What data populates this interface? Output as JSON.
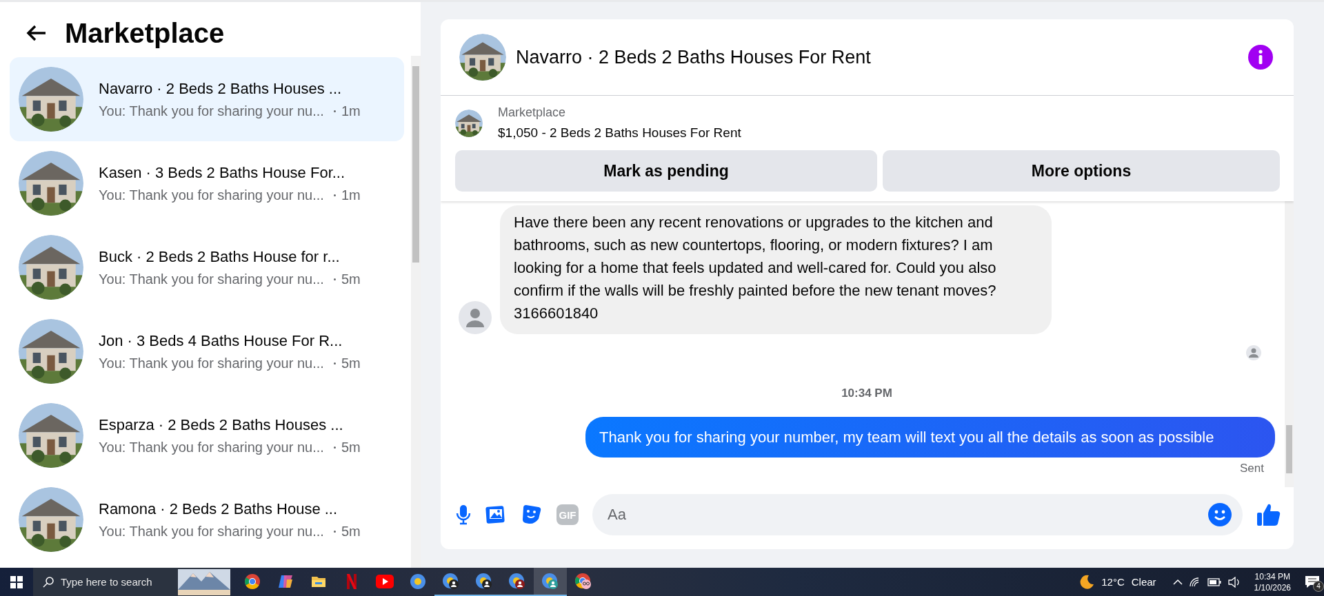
{
  "sidebar": {
    "title": "Marketplace",
    "conversations": [
      {
        "name": "Navarro · 2 Beds 2 Baths Houses ...",
        "preview": "You: Thank you for sharing your nu...",
        "time": "1m",
        "selected": true
      },
      {
        "name": "Kasen · 3 Beds 2 Baths House For...",
        "preview": "You: Thank you for sharing your nu...",
        "time": "1m",
        "selected": false
      },
      {
        "name": "Buck · 2 Beds 2 Baths House for r...",
        "preview": "You: Thank you for sharing your nu...",
        "time": "5m",
        "selected": false
      },
      {
        "name": "Jon · 3 Beds 4 Baths House For R...",
        "preview": "You: Thank you for sharing your nu...",
        "time": "5m",
        "selected": false
      },
      {
        "name": "Esparza · 2 Beds 2 Baths Houses ...",
        "preview": "You: Thank you for sharing your nu...",
        "time": "5m",
        "selected": false
      },
      {
        "name": "Ramona · 2 Beds 2 Baths House ...",
        "preview": "You: Thank you for sharing your nu...",
        "time": "5m",
        "selected": false
      }
    ]
  },
  "chat": {
    "title": "Navarro · 2 Beds 2 Baths Houses For Rent",
    "listing": {
      "source": "Marketplace",
      "summary": "$1,050 - 2 Beds 2 Baths Houses For Rent",
      "buttons": [
        "Mark as pending",
        "More options"
      ]
    },
    "messages": [
      {
        "kind": "incoming",
        "text": "Have there been any recent renovations or upgrades to the kitchen and bathrooms, such as new countertops, flooring, or modern fixtures? I am looking for a home that feels updated and well-cared for. Could you also confirm if the walls will be freshly painted before the new tenant moves? 3166601840"
      },
      {
        "kind": "seen"
      },
      {
        "kind": "time",
        "text": "10:34 PM"
      },
      {
        "kind": "outgoing",
        "text": "Thank you for  sharing your number, my team will text you all the details as soon as possible",
        "status": "Sent"
      }
    ],
    "composer": {
      "gif": "GIF",
      "placeholder": "Aa"
    }
  },
  "taskbar": {
    "search_placeholder": "Type here to search",
    "apps": [
      {
        "kind": "chrome",
        "running": false,
        "selected": false
      },
      {
        "kind": "copilot",
        "running": false,
        "selected": false
      },
      {
        "kind": "folder",
        "running": false,
        "selected": false
      },
      {
        "kind": "netflix",
        "running": false,
        "selected": false
      },
      {
        "kind": "youtube",
        "running": false,
        "selected": false
      },
      {
        "kind": "chrome-canary",
        "running": false,
        "selected": false
      },
      {
        "kind": "chrome-profile",
        "running": true,
        "selected": false
      },
      {
        "kind": "chrome-profile",
        "running": true,
        "selected": false
      },
      {
        "kind": "chrome-profile-red",
        "running": true,
        "selected": false
      },
      {
        "kind": "chrome-profile-teal",
        "running": true,
        "selected": true
      },
      {
        "kind": "chrome-glasses",
        "running": false,
        "selected": false
      }
    ],
    "temperature": "12°C",
    "weather": "Clear",
    "time": "10:34 PM",
    "date": "1/10/2026",
    "notifications": "4"
  }
}
